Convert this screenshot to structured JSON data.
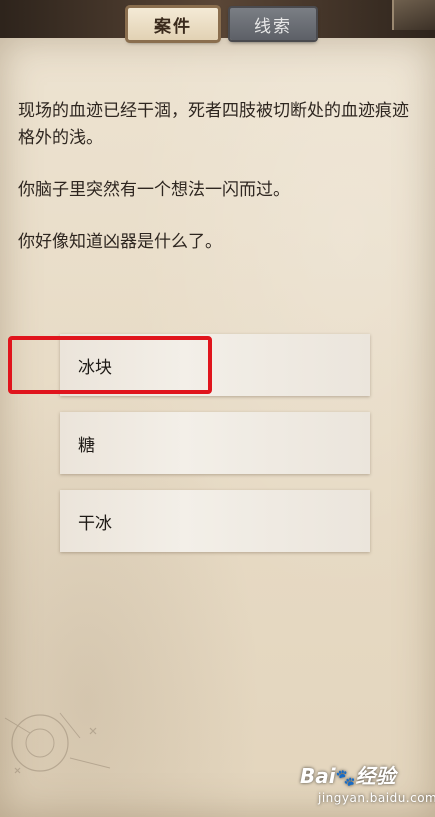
{
  "tabs": [
    {
      "label": "案件",
      "active": true
    },
    {
      "label": "线索",
      "active": false
    }
  ],
  "story": {
    "paragraph1": "现场的血迹已经干涸，死者四肢被切断处的血迹痕迹格外的浅。",
    "paragraph2": "你脑子里突然有一个想法一闪而过。",
    "paragraph3": "你好像知道凶器是什么了。"
  },
  "options": [
    {
      "label": "冰块",
      "highlighted": true
    },
    {
      "label": "糖",
      "highlighted": false
    },
    {
      "label": "干冰",
      "highlighted": false
    }
  ],
  "watermark": {
    "logo_left": "Bai",
    "logo_paw": "🐾",
    "logo_right": "经验",
    "url": "jingyan.baidu.com"
  },
  "colors": {
    "paper": "#e8dcc7",
    "highlight": "#e0141c",
    "active_tab": "#f4ead6",
    "inactive_tab": "#6b6e74"
  }
}
